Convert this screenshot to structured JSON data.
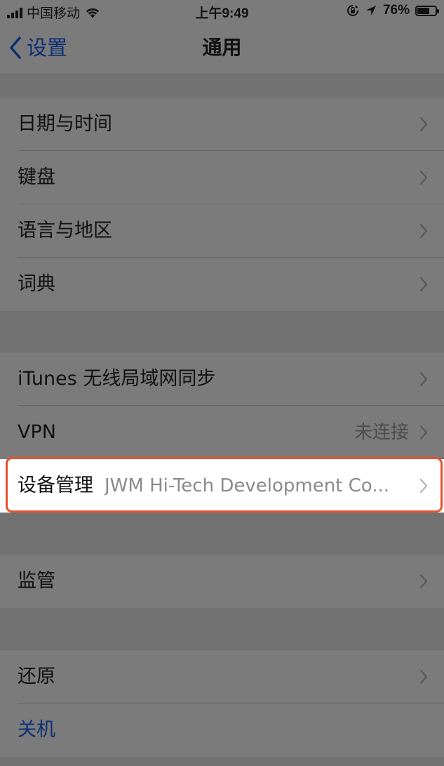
{
  "status_bar": {
    "carrier": "中国移动",
    "time": "上午9:49",
    "battery_percent": "76%",
    "battery_level": 0.76,
    "icons": [
      "signal-icon",
      "wifi-icon",
      "rotation-lock-icon",
      "location-icon",
      "battery-icon"
    ]
  },
  "nav": {
    "back_label": "设置",
    "title": "通用"
  },
  "groups": [
    {
      "rows": [
        {
          "label": "日期与时间"
        },
        {
          "label": "键盘"
        },
        {
          "label": "语言与地区"
        },
        {
          "label": "词典"
        }
      ]
    },
    {
      "rows": [
        {
          "label": "iTunes 无线局域网同步"
        },
        {
          "label": "VPN",
          "value": "未连接"
        },
        {
          "label": "设备管理",
          "value": "JWM Hi-Tech Development Co..."
        }
      ]
    },
    {
      "rows": [
        {
          "label": "监管"
        }
      ]
    },
    {
      "rows": [
        {
          "label": "还原"
        },
        {
          "label": "关机"
        }
      ]
    }
  ],
  "colors": {
    "dim_background": "#727273",
    "cell_background": "#7b7b7c",
    "highlight_background": "#ffffff",
    "highlight_border": "#e8512f",
    "link_color": "#0c2f73"
  }
}
